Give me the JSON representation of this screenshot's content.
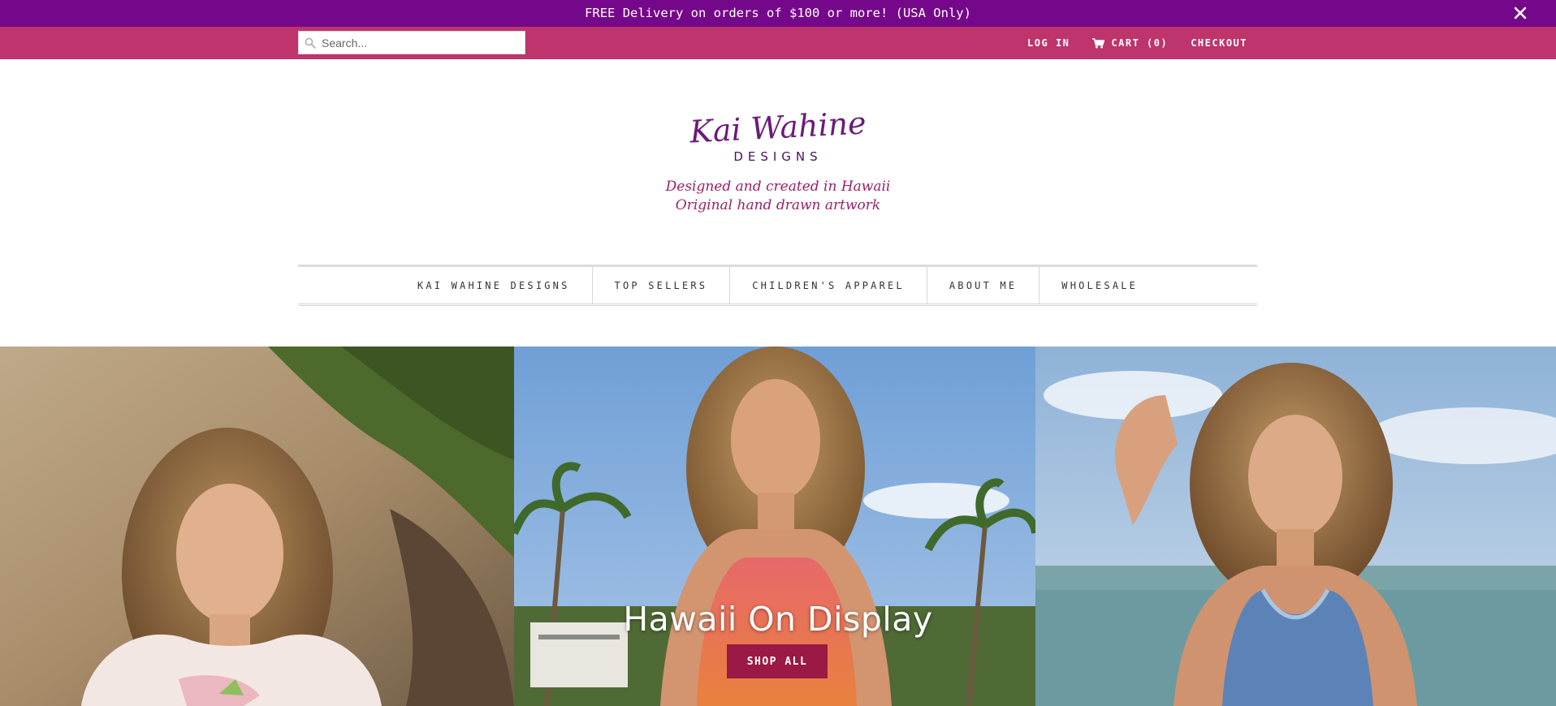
{
  "announcement": {
    "text": "FREE Delivery on orders of $100 or more! (USA Only)",
    "close_icon": "close-icon"
  },
  "utility": {
    "search_placeholder": "Search...",
    "login_label": "LOG IN",
    "cart_label": "CART (0)",
    "checkout_label": "CHECKOUT"
  },
  "logo": {
    "name_line1": "Kai Wahine",
    "name_line2": "DESIGNS",
    "tagline_line1": "Designed and created in Hawaii",
    "tagline_line2": "Original hand drawn artwork"
  },
  "nav": {
    "items": [
      {
        "label": "KAI WAHINE DESIGNS"
      },
      {
        "label": "TOP SELLERS"
      },
      {
        "label": "CHILDREN'S APPAREL"
      },
      {
        "label": "ABOUT ME"
      },
      {
        "label": "WHOLESALE"
      }
    ]
  },
  "hero": {
    "title": "Hawaii On Display",
    "button_label": "SHOP ALL"
  },
  "colors": {
    "announcement_bg": "#75088a",
    "utility_bg": "#be346c",
    "button_bg": "#9a1945",
    "logo_purple": "#6b1a7a",
    "logo_magenta": "#9b1f6a"
  }
}
